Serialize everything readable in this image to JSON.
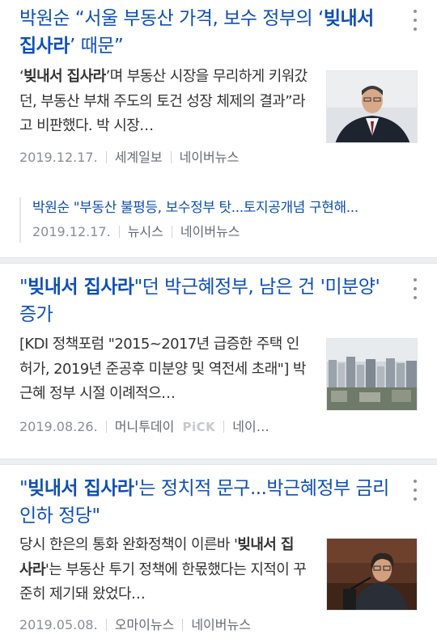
{
  "articles": [
    {
      "title_parts": [
        "박원순 “서울 부동산 가격, 보수 정부의 ‘",
        "빚내서 집사라",
        "’ 때문”"
      ],
      "summary_parts": [
        "‘",
        "빚내서 집사라",
        "’며 부동산 시장을 무리하게 키워갔던, 부동산 부채 주도의 토건 성장 체제의 결과”라고 비판했다. 박 시장…"
      ],
      "date": "2019.12.17.",
      "source": "세계일보",
      "portal": "네이버뉴스",
      "thumb_icon": "portrait-photo-icon",
      "related": {
        "title": "박원순 \"부동산 불평등, 보수정부 탓...토지공개념 구현해...",
        "date": "2019.12.17.",
        "source": "뉴시스",
        "portal": "네이버뉴스"
      }
    },
    {
      "title_parts": [
        "\"",
        "빚내서 집사라",
        "\"던 박근혜정부, 남은 건 '미분양' 증가"
      ],
      "summary_parts": [
        "[KDI 정책포럼 \"2015~2017년 급증한 주택 인허가, 2019년 준공후 미분양 및 역전세 초래\"] 박근혜 정부 시절 이례적으…"
      ],
      "date": "2019.08.26.",
      "source": "머니투데이",
      "pick": "PiCK",
      "portal": "네이…",
      "thumb_icon": "city-apartments-photo-icon"
    },
    {
      "title_parts": [
        "\"",
        "빚내서 집사라",
        "'는 정치적 문구...박근혜정부 금리인하 정당\""
      ],
      "summary_parts": [
        "당시 한은의 통화 완화정책이 이른바 '",
        "빚내서 집 사라",
        "'는 부동산 투기 정책에 한몫했다는 지적이 꾸준히 제기돼 왔었다…"
      ],
      "date": "2019.05.08.",
      "source": "오마이뉴스",
      "portal": "네이버뉴스",
      "thumb_icon": "speaker-photo-icon"
    }
  ]
}
